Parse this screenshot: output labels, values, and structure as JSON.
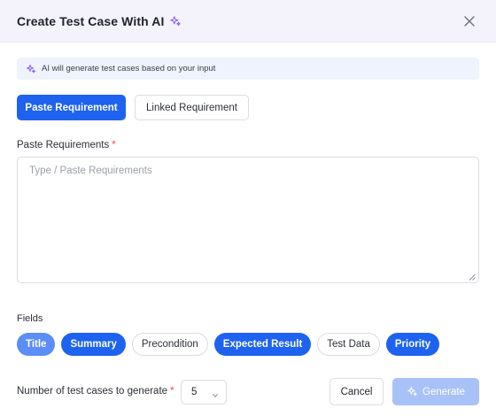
{
  "dialog": {
    "title": "Create Test Case With AI",
    "title_icon": "ai-sparkle-icon",
    "close_icon": "close-icon"
  },
  "banner": {
    "icon": "ai-sparkle-icon",
    "text": "AI will generate test cases based on your input"
  },
  "tabs": [
    {
      "label": "Paste Requirement",
      "active": true
    },
    {
      "label": "Linked Requirement",
      "active": false
    }
  ],
  "requirements": {
    "label": "Paste Requirements",
    "required_mark": "*",
    "placeholder": "Type / Paste Requirements",
    "value": ""
  },
  "fields": {
    "label": "Fields",
    "chips": [
      {
        "label": "Title",
        "selected": true
      },
      {
        "label": "Summary",
        "selected": true
      },
      {
        "label": "Precondition",
        "selected": false
      },
      {
        "label": "Expected Result",
        "selected": true
      },
      {
        "label": "Test Data",
        "selected": false
      },
      {
        "label": "Priority",
        "selected": true
      }
    ]
  },
  "count": {
    "label": "Number of test cases to generate",
    "required_mark": "*",
    "value": "5"
  },
  "actions": {
    "cancel_label": "Cancel",
    "generate_label": "Generate",
    "generate_disabled": true
  },
  "colors": {
    "primary": "#1e62f0",
    "primary_disabled": "#a8c2f7",
    "accent_icon": "#8b5cf6",
    "required": "#e5484d",
    "header_bg": "#f4f3fb",
    "banner_bg": "#eef3fd"
  }
}
